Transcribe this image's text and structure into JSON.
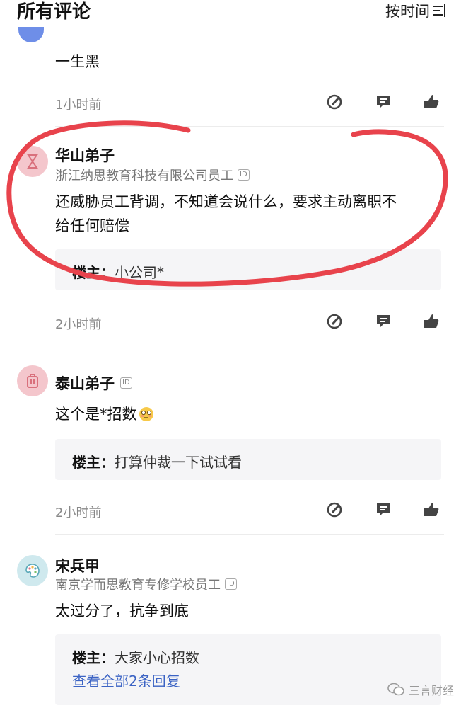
{
  "header": {
    "title": "所有评论",
    "sort_label": "按时间"
  },
  "comments": [
    {
      "text": "一生黑",
      "time": "1小时前"
    },
    {
      "name": "华山弟子",
      "company": "浙江纳思教育科技有限公司员工",
      "text1": "还威胁员工背调，不知道会说什么，要求主动离职不",
      "text2": "给任何赔偿",
      "reply_author": "楼主：",
      "reply_text": "小公司*",
      "time": "2小时前"
    },
    {
      "name": "泰山弟子",
      "text": "这个是*招数",
      "reply_author": "楼主：",
      "reply_text": "打算仲裁一下试试看",
      "time": "2小时前"
    },
    {
      "name": "宋兵甲",
      "company": "南京学而思教育专修学校员工",
      "text": "太过分了，抗争到底",
      "reply_author": "楼主：",
      "reply_text": "大家小心招数",
      "view_all": "查看全部2条回复"
    }
  ],
  "id_badge": "ID",
  "watermark": "三言财经",
  "colors": {
    "highlight_stroke": "#e8434c",
    "link": "#3b63c4",
    "avatar_pink": "#f4c6cc",
    "avatar_teal": "#cfe9ee"
  }
}
